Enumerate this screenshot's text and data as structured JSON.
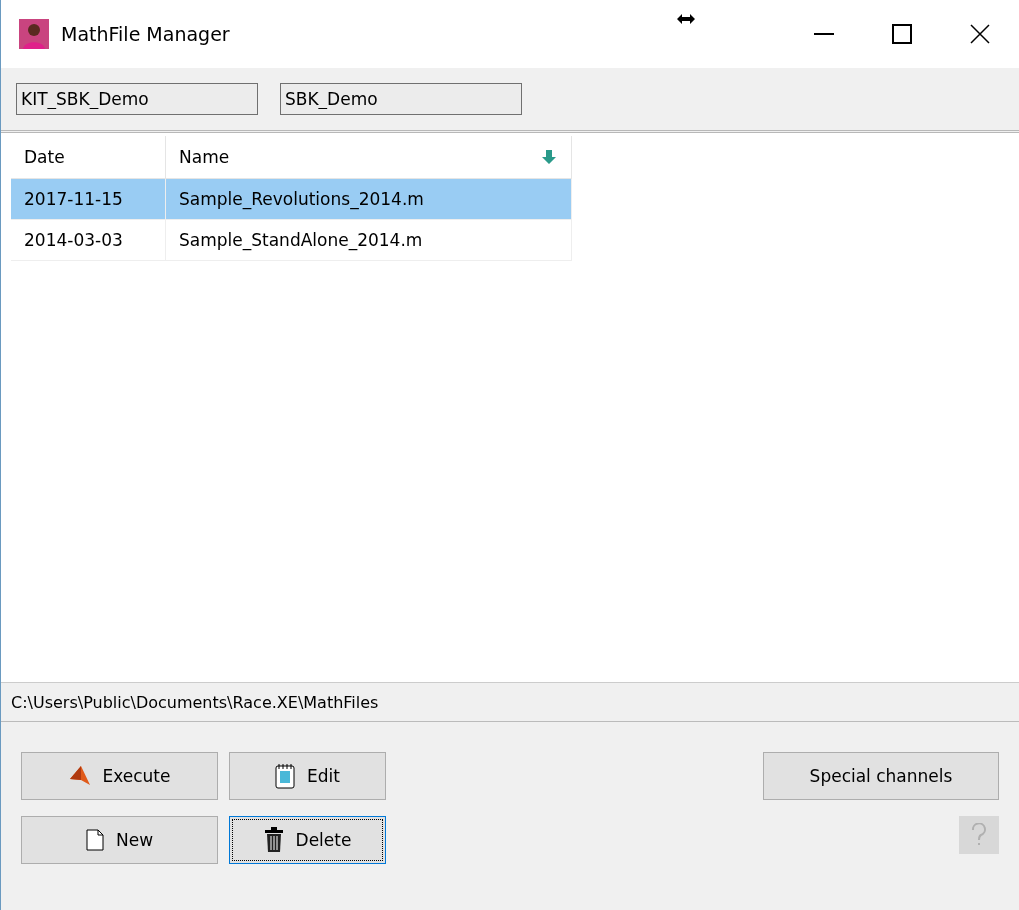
{
  "window": {
    "title": "MathFile Manager"
  },
  "fields": [
    {
      "value": "KIT_SBK_Demo"
    },
    {
      "value": "SBK_Demo"
    }
  ],
  "table": {
    "columns": [
      {
        "label": "Date",
        "sorted": false
      },
      {
        "label": "Name",
        "sorted": true
      }
    ],
    "rows": [
      {
        "cells": [
          "2017-11-15",
          "Sample_Revolutions_2014.m"
        ],
        "selected": true
      },
      {
        "cells": [
          "2014-03-03",
          "Sample_StandAlone_2014.m"
        ],
        "selected": false
      }
    ]
  },
  "path": "C:\\Users\\Public\\Documents\\Race.XE\\MathFiles",
  "buttons": [
    {
      "label": "Execute",
      "focused": false
    },
    {
      "label": "Edit",
      "focused": false
    },
    {
      "label": "New",
      "focused": false
    },
    {
      "label": "Delete",
      "focused": true
    }
  ],
  "special_button": {
    "label": "Special channels"
  },
  "help_button": {
    "disabled": true
  }
}
